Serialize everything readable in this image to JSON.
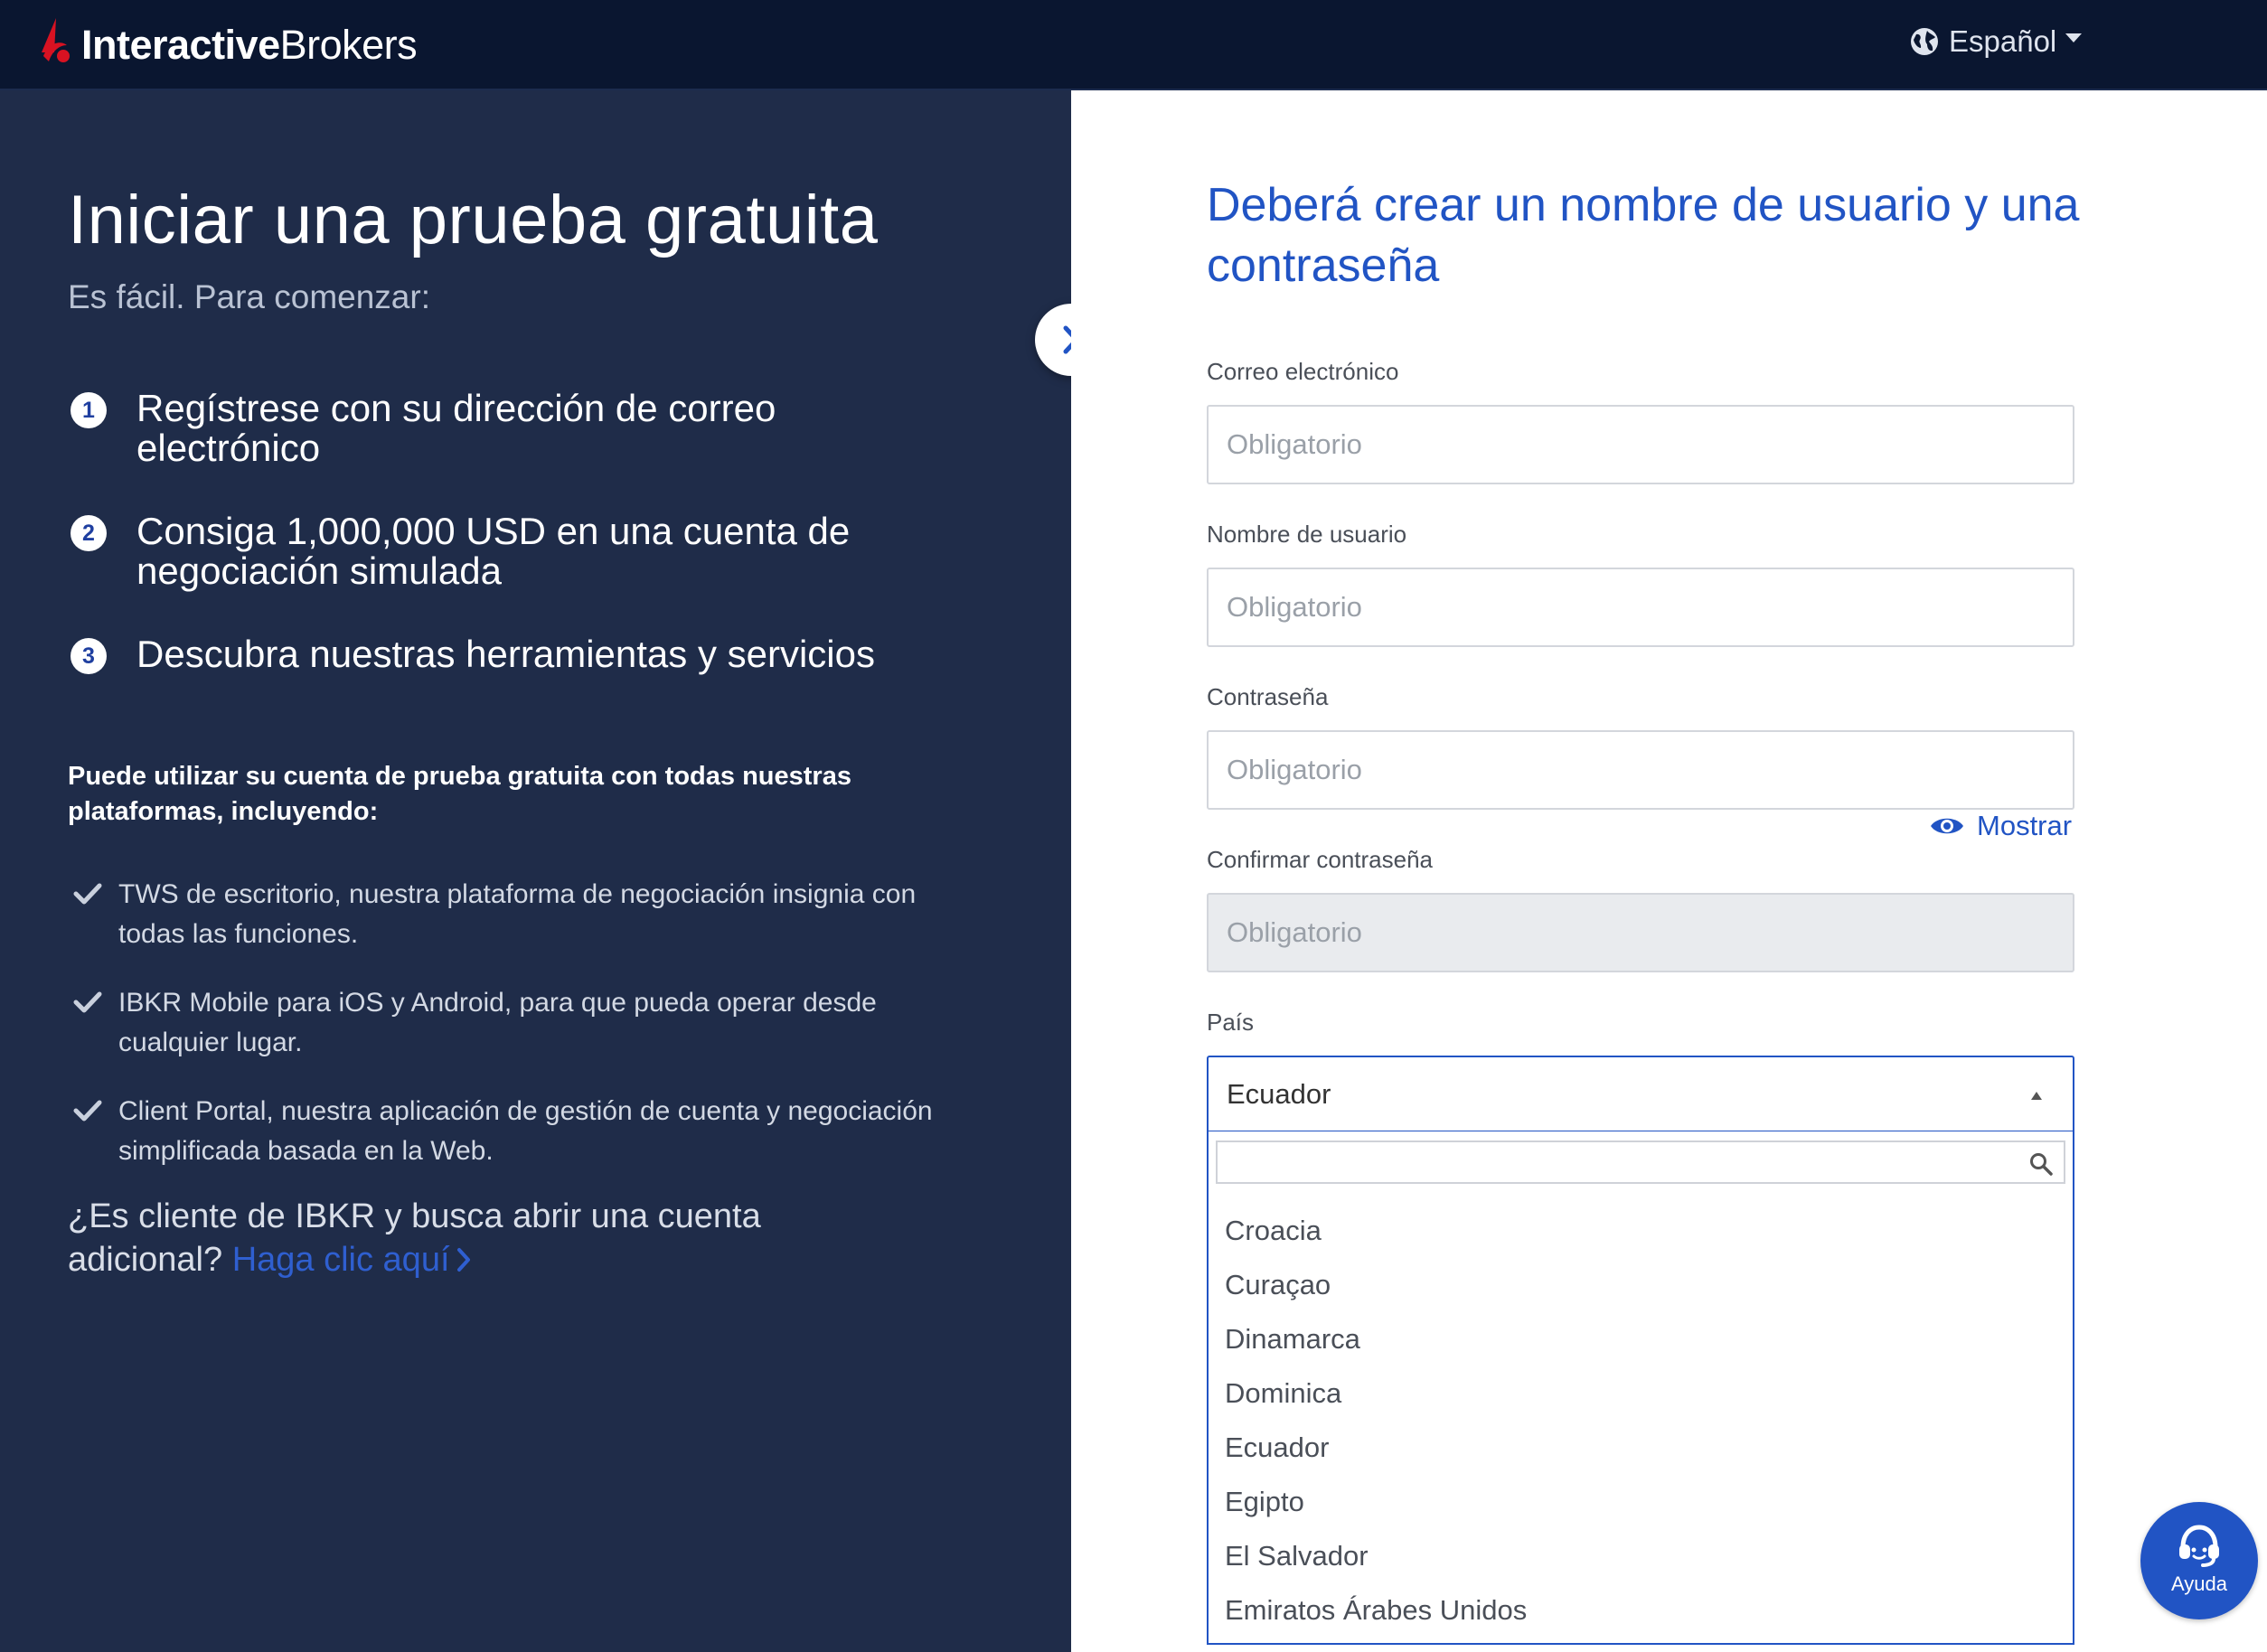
{
  "header": {
    "brand_bold": "Interactive",
    "brand_light": "Brokers",
    "language": "Español"
  },
  "left": {
    "title": "Iniciar una prueba gratuita",
    "subtitle": "Es fácil. Para comenzar:",
    "steps": [
      {
        "num": "1",
        "text": "Regístrese con su dirección de correo electrónico"
      },
      {
        "num": "2",
        "text": "Consiga 1,000,000 USD en una cuenta de negociación simulada"
      },
      {
        "num": "3",
        "text": "Descubra nuestras herramientas y servicios"
      }
    ],
    "platforms_intro": "Puede utilizar su cuenta de prueba gratuita con todas nuestras plataformas, incluyendo:",
    "platforms": [
      "TWS de escritorio, nuestra plataforma de negociación insignia con todas las funciones.",
      "IBKR Mobile para iOS y Android, para que pueda operar desde cualquier lugar.",
      "Client Portal, nuestra aplicación de gestión de cuenta y negociación simplificada basada en la Web."
    ],
    "client_question": "¿Es cliente de IBKR y busca abrir una cuenta adicional?",
    "client_link": "Haga clic aquí"
  },
  "form": {
    "title": "Deberá crear un nombre de usuario y una contraseña",
    "email_label": "Correo electrónico",
    "email_placeholder": "Obligatorio",
    "username_label": "Nombre de usuario",
    "username_placeholder": "Obligatorio",
    "password_label": "Contraseña",
    "password_placeholder": "Obligatorio",
    "show_label": "Mostrar",
    "confirm_label": "Confirmar contraseña",
    "confirm_placeholder": "Obligatorio",
    "country_label": "País",
    "country_selected": "Ecuador",
    "country_search_value": "",
    "country_options": [
      "Croacia",
      "Curaçao",
      "Dinamarca",
      "Dominica",
      "Ecuador",
      "Egipto",
      "El Salvador",
      "Emiratos Árabes Unidos"
    ]
  },
  "help": {
    "label": "Ayuda"
  },
  "colors": {
    "topbar": "#0a1630",
    "left_panel": "#1f2c49",
    "accent_blue": "#2154c4",
    "brand_red": "#d81222"
  },
  "icons": {
    "logo": "ib-logo-icon",
    "language": "globe-icon",
    "toggle": "chevron-right-icon",
    "show": "eye-icon",
    "search": "search-icon",
    "help": "headset-icon",
    "check": "checkmark-icon"
  }
}
